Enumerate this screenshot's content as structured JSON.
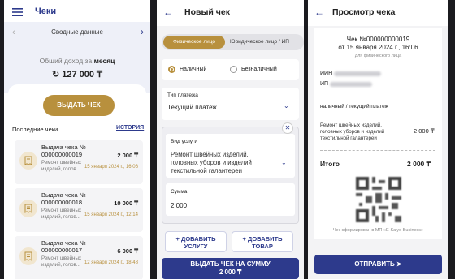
{
  "colors": {
    "navy": "#2d3a8c",
    "gold": "#b8903d",
    "background": "#1b1b1f"
  },
  "screen1": {
    "title": "Чеки",
    "subtitle": "Сводные данные",
    "income_label_prefix": "Общий доход за",
    "income_label_period": "месяц",
    "income_value": "127 000 ₸",
    "issue_button": "ВЫДАТЬ ЧЕК",
    "recent_label": "Последние чеки",
    "history_link": "ИСТОРИЯ",
    "receipts": [
      {
        "title": "Выдача чека № 000000000019",
        "desc": "Ремонт швейных изделий, голов...",
        "amount": "2 000 ₸",
        "date": "15 января 2024 г., 16:06"
      },
      {
        "title": "Выдача чека № 000000000018",
        "desc": "Ремонт швейных изделий, голов...",
        "amount": "10 000 ₸",
        "date": "15 января 2024 г., 12:14"
      },
      {
        "title": "Выдача чека № 000000000017",
        "desc": "Ремонт швейных изделий, голов...",
        "amount": "6 000 ₸",
        "date": "12 января 2024 г., 18:48"
      }
    ]
  },
  "screen2": {
    "title": "Новый чек",
    "tab_individual": "Физическое лицо",
    "tab_legal": "Юридическое лицо / ИП",
    "payment_cash": "Наличный",
    "payment_card": "Безналичный",
    "payment_type_label": "Тип платежа",
    "payment_type_value": "Текущий платеж",
    "service_label": "Вид услуги",
    "service_value": "Ремонт швейных изделий, головных уборов и изделий текстильной галантереи",
    "sum_label": "Сумма",
    "sum_value": "2 000",
    "add_service": "+ ДОБАВИТЬ УСЛУГУ",
    "add_product": "+ ДОБАВИТЬ ТОВАР",
    "issue_button_line1": "ВЫДАТЬ ЧЕК НА СУММУ",
    "issue_button_line2": "2 000 ₸"
  },
  "screen3": {
    "title": "Просмотр чека",
    "check_number": "Чек №000000000019",
    "check_date": "от 15 января 2024 г., 16:06",
    "for_individual": "для физического лица",
    "inn_label": "ИИН",
    "ip_label": "ИП",
    "payment_text": "наличный / текущий платеж",
    "item_name": "Ремонт швейных изделий, головных уборов и изделий текстильной галантереи",
    "item_amount": "2 000 ₸",
    "total_label": "Итого",
    "total_value": "2 000 ₸",
    "footer": "Чек сформирован в МП «E-Salyq Business»",
    "send_button": "ОТПРАВИТЬ"
  }
}
